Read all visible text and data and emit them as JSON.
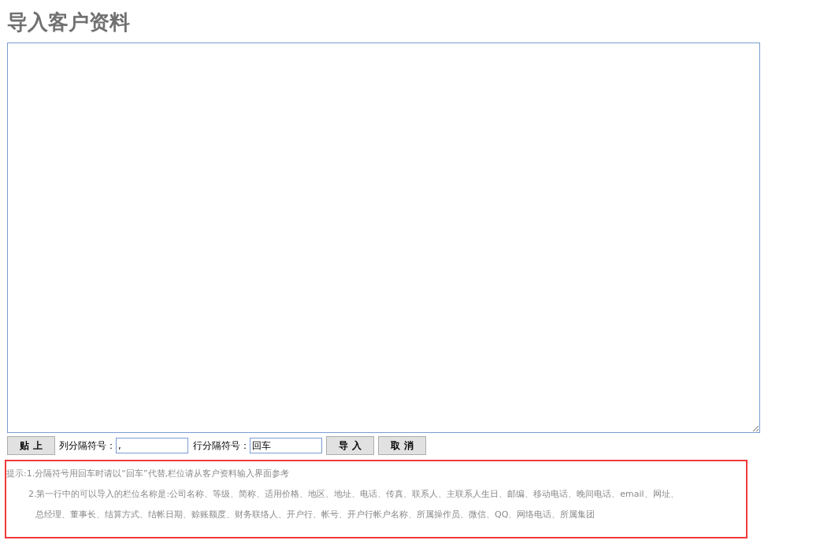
{
  "title": "导入客户资料",
  "paste_button": "贴 上",
  "column_separator": {
    "label": "列分隔符号：",
    "value": ","
  },
  "row_separator": {
    "label": "行分隔符号：",
    "value": "回车"
  },
  "import_button": "导 入",
  "cancel_button": "取 消",
  "tips": [
    "提示:1.分隔符号用回车时请以“回车”代替,栏位请从客户资料输入界面参考",
    "2.第一行中的可以导入的栏位名称是:公司名称、等级、简称、适用价格、地区、地址、电话、传真、联系人、主联系人生日、邮编、移动电话、晚间电话、email、网址、",
    "总经理、董事长、结算方式、结帐日期、赊账额度、财务联络人、开户行、帐号、开户行帐户名称、所属操作员、微信、QQ、网络电话、所属集团"
  ]
}
